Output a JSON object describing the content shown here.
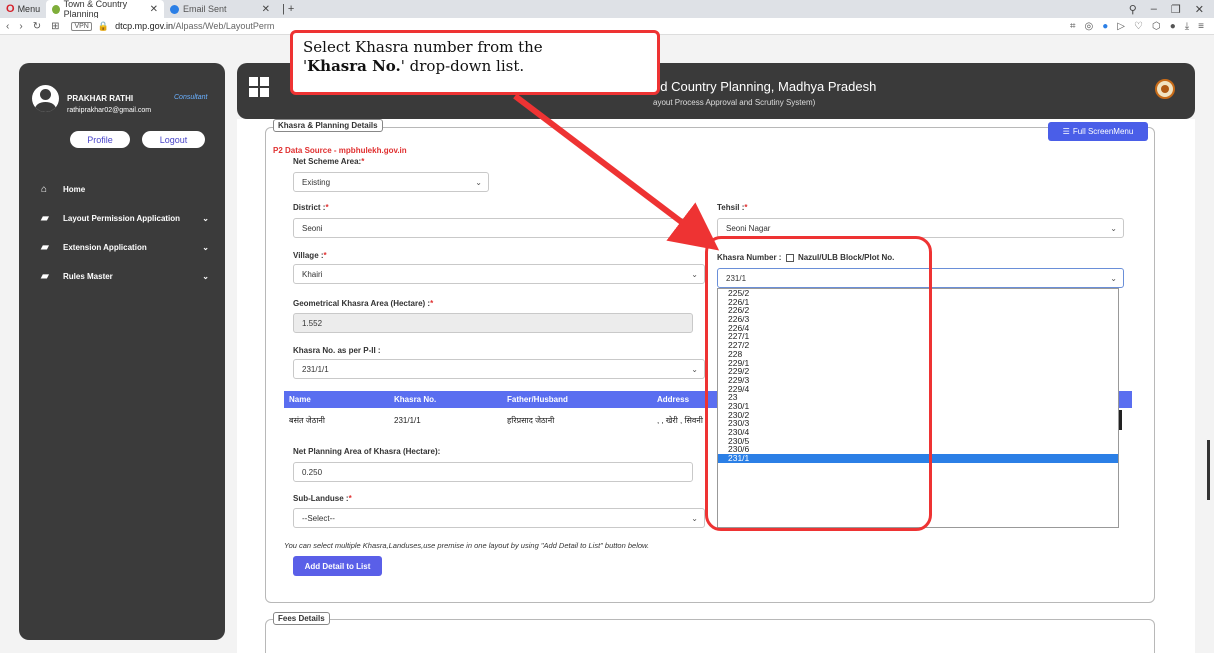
{
  "browser": {
    "menu_label": "Menu",
    "tabs": [
      {
        "label": "Town & Country Planning"
      },
      {
        "label": "Email Sent"
      }
    ],
    "url_domain": "dtcp.mp.gov.in",
    "url_path": "/Alpass/Web/LayoutPerm"
  },
  "sidebar": {
    "user_name": "PRAKHAR RATHI",
    "user_role": "Consultant",
    "user_email": "rathiprakhar02@gmail.com",
    "profile_label": "Profile",
    "logout_label": "Logout",
    "items": [
      {
        "label": "Home"
      },
      {
        "label": "Layout Permission Application"
      },
      {
        "label": "Extension Application"
      },
      {
        "label": "Rules Master"
      }
    ]
  },
  "header": {
    "title": "nd Country Planning, Madhya Pradesh",
    "subtitle": "ayout Process Approval and Scrutiny System)"
  },
  "callout": {
    "line1": "Select Khasra number from the",
    "quote_open": "'",
    "bold": "Khasra No.",
    "line2_rest": "' drop-down list."
  },
  "form": {
    "section_title": "Khasra & Planning Details",
    "fullscreen_label": "Full ScreenMenu",
    "data_source": "P2 Data Source - mpbhulekh.gov.in",
    "net_scheme_area_label": "Net Scheme Area:",
    "net_scheme_area_value": "Existing",
    "district_label": "District :",
    "district_value": "Seoni",
    "tehsil_label": "Tehsil :",
    "tehsil_value": "Seoni Nagar",
    "village_label": "Village :",
    "village_value": "Khairi",
    "khasra_number_label": "Khasra Number :",
    "nazul_label": "Nazul/ULB Block/Plot No.",
    "khasra_number_value": "231/1",
    "geo_area_label": "Geometrical Khasra Area (Hectare) :",
    "geo_area_value": "1.552",
    "khasra_p2_label": "Khasra No. as per P-II :",
    "khasra_p2_value": "231/1/1",
    "table": {
      "headers": [
        "Name",
        "Khasra No.",
        "Father/Husband",
        "Address"
      ],
      "rows": [
        [
          "बसंत जेठानी",
          "231/1/1",
          "हरिप्रसाद जेठानी",
          ", , खेरी , सिवनी"
        ]
      ]
    },
    "net_planning_label": "Net Planning Area of Khasra (Hectare):",
    "net_planning_value": "0.250",
    "sub_landuse_label": "Sub-Landuse :",
    "sub_landuse_value": "--Select--",
    "hint": "You can select multiple Khasra,Landuses,use premise in one layout by using \"Add Detail to List\" button below.",
    "add_button": "Add Detail to List",
    "required_mark": "*"
  },
  "fees": {
    "section_title": "Fees Details"
  },
  "dropdown": {
    "options": [
      "225/2",
      "226/1",
      "226/2",
      "226/3",
      "226/4",
      "227/1",
      "227/2",
      "228",
      "229/1",
      "229/2",
      "229/3",
      "229/4",
      "23",
      "230/1",
      "230/2",
      "230/3",
      "230/4",
      "230/5",
      "230/6",
      "231/1"
    ],
    "selected": "231/1"
  },
  "colors": {
    "accent": "#5a6ef0",
    "callout_border": "#e33333",
    "selected_option": "#2b7fe6"
  }
}
